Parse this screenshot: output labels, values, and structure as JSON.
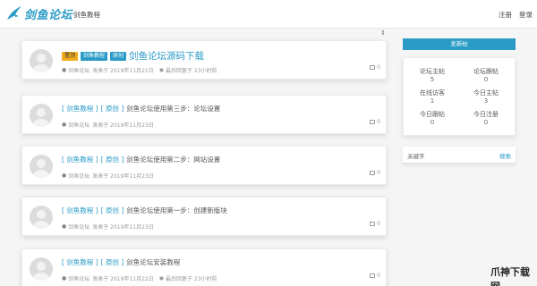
{
  "header": {
    "logo_text": "剑鱼论坛",
    "nav": {
      "tutorial": "剑鱼教程",
      "register": "注册",
      "login": "登录"
    }
  },
  "posts": [
    {
      "tags": [
        "置顶",
        "剑鱼教程",
        "原创"
      ],
      "title": "剑鱼论坛源码下载",
      "author": "剑鱼论坛",
      "posted": "发表于 2019年11月21日",
      "last_reply": "最后回复于 23小时前",
      "replies": "0"
    },
    {
      "board": "剑鱼教程",
      "type": "原创",
      "title": "剑鱼论坛使用第三步：论坛设置",
      "author": "剑鱼论坛",
      "posted": "发表于 2019年11月23日",
      "replies": "0"
    },
    {
      "board": "剑鱼教程",
      "type": "原创",
      "title": "剑鱼论坛使用第二步：网站设置",
      "author": "剑鱼论坛",
      "posted": "发表于 2019年11月23日",
      "replies": "0"
    },
    {
      "board": "剑鱼教程",
      "type": "原创",
      "title": "剑鱼论坛使用第一步：创建新版块",
      "author": "剑鱼论坛",
      "posted": "发表于 2019年11月23日",
      "replies": "0"
    },
    {
      "board": "剑鱼教程",
      "type": "原创",
      "title": "剑鱼论坛安装教程",
      "author": "剑鱼论坛",
      "posted": "发表于 2019年11月22日",
      "last_reply": "最后回复于 23小时前",
      "replies": "0"
    }
  ],
  "sidebar": {
    "post_button": "发新帖",
    "stats": {
      "threads_label": "论坛主帖",
      "threads_value": "5",
      "replies_label": "论坛跟帖",
      "replies_value": "0",
      "online_label": "在线访客",
      "online_value": "1",
      "today_threads_label": "今日主帖",
      "today_threads_value": "3",
      "today_replies_label": "今日跟帖",
      "today_replies_value": "0",
      "today_reg_label": "今日注册",
      "today_reg_value": "0"
    },
    "search": {
      "label": "关键字",
      "button": "搜索"
    }
  },
  "watermark": "爪神下载网",
  "colors": {
    "accent": "#2a9bc7",
    "top_tag": "#f0ad1e"
  }
}
